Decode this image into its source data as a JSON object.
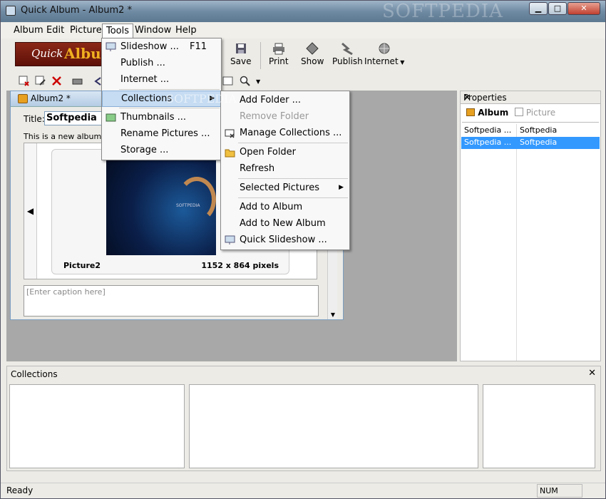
{
  "window": {
    "title": "Quick Album - Album2 *",
    "watermark": "SOFTPEDIA"
  },
  "menubar": [
    "Album",
    "Edit",
    "Picture",
    "Tools",
    "Window",
    "Help"
  ],
  "logo": {
    "part1": "Quick",
    "part2": "Album"
  },
  "toolbar": {
    "save": "Save",
    "print": "Print",
    "show": "Show",
    "publish": "Publish",
    "internet": "Internet"
  },
  "album": {
    "tab_title": "Album2 *",
    "title_label": "Title:",
    "title_value": "Softpedia",
    "description": "This is a new album.",
    "picture_name": "Picture2",
    "picture_size": "1152 x 864 pixels",
    "caption_placeholder": "[Enter caption here]"
  },
  "tools_menu": [
    {
      "label": "Slideshow ...",
      "shortcut": "F11"
    },
    {
      "label": "Publish ..."
    },
    {
      "label": "Internet ..."
    },
    {
      "label": "Collections"
    },
    {
      "label": "Thumbnails ..."
    },
    {
      "label": "Rename Pictures ..."
    },
    {
      "label": "Storage ..."
    }
  ],
  "collections_menu": [
    {
      "label": "Add Folder ..."
    },
    {
      "label": "Remove Folder"
    },
    {
      "label": "Manage Collections ..."
    },
    {
      "label": "Open Folder"
    },
    {
      "label": "Refresh"
    },
    {
      "label": "Selected Pictures"
    },
    {
      "label": "Add to Album"
    },
    {
      "label": "Add to New Album"
    },
    {
      "label": "Quick Slideshow ..."
    }
  ],
  "properties": {
    "header": "Properties",
    "tab_album": "Album",
    "tab_picture": "Picture",
    "rows": [
      {
        "key": "Softpedia ...",
        "value": "Softpedia"
      },
      {
        "key": "Softpedia ...",
        "value": "Softpedia"
      }
    ]
  },
  "collections_panel": {
    "header": "Collections"
  },
  "statusbar": {
    "left": "Ready",
    "num": "NUM"
  },
  "overlay": {
    "watermark2": "SOFTPEDIA"
  }
}
